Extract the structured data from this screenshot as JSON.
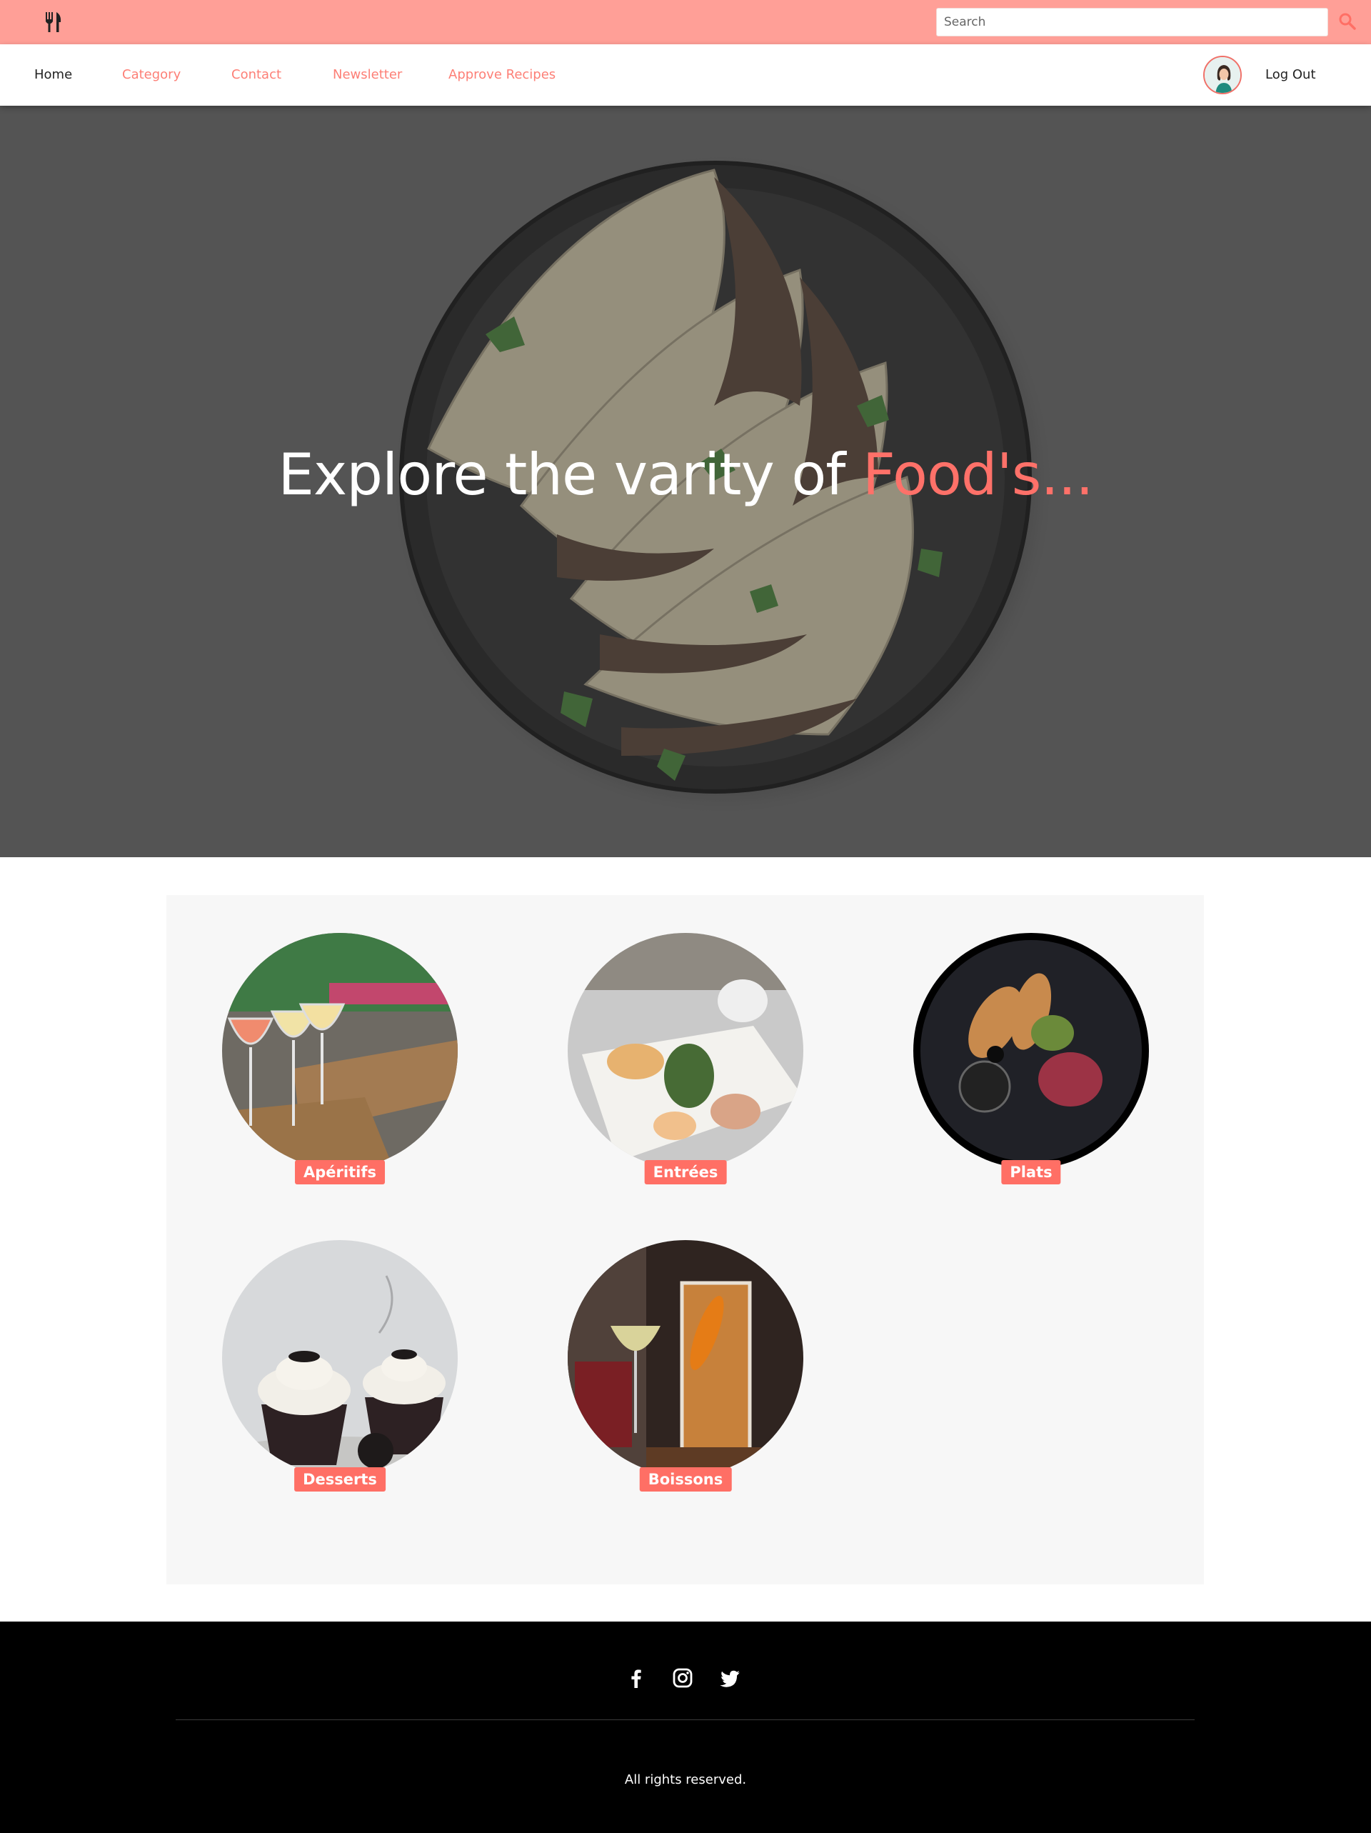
{
  "topbar": {
    "logo_icon": "utensils-icon",
    "search_placeholder": "Search",
    "search_icon": "search-icon"
  },
  "nav": {
    "links": [
      "Home",
      "Category",
      "Contact",
      "Newsletter",
      "Approve Recipes"
    ],
    "logout_label": "Log Out"
  },
  "hero": {
    "title_main": "Explore the varity of ",
    "title_accent": "Food's..."
  },
  "categories": [
    {
      "label": "Apéritifs"
    },
    {
      "label": "Entrées"
    },
    {
      "label": "Plats"
    },
    {
      "label": "Desserts"
    },
    {
      "label": "Boissons"
    }
  ],
  "footer": {
    "social_icons": [
      "facebook-icon",
      "instagram-icon",
      "twitter-icon"
    ],
    "copyright": "All rights reserved."
  },
  "colors": {
    "topbar": "#ff9f97",
    "accent": "#ff6f65",
    "hero_overlay": "#555555",
    "footer": "#000000"
  }
}
